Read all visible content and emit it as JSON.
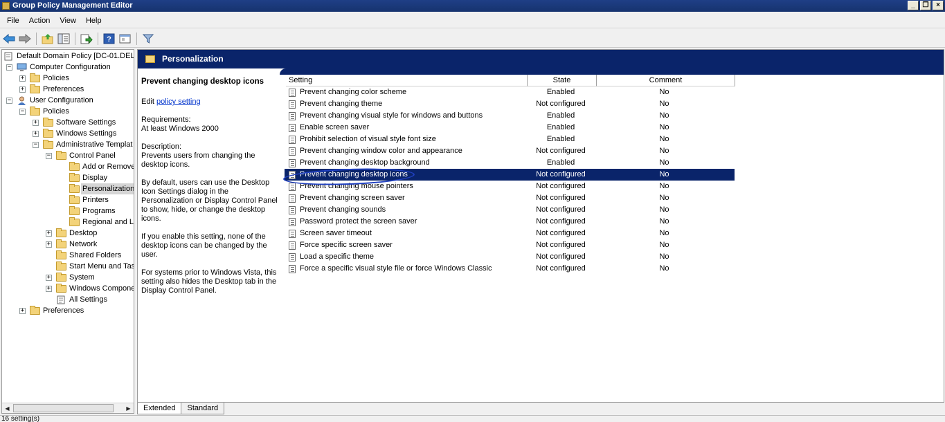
{
  "window": {
    "title": "Group Policy Management Editor"
  },
  "menu": [
    "File",
    "Action",
    "View",
    "Help"
  ],
  "toolbar": {
    "icons": [
      "back-arrow-icon",
      "forward-arrow-icon",
      "up-folder-icon",
      "show-hide-tree-icon",
      "export-list-icon",
      "help-icon",
      "properties-icon",
      "filter-icon"
    ]
  },
  "tree": [
    {
      "label": "Default Domain Policy [DC-01.DELT",
      "icon": "gpo-scroll-icon",
      "expander": "",
      "selected": false
    },
    {
      "label": "Computer Configuration",
      "icon": "computer-icon",
      "expander": "−",
      "selected": false
    },
    {
      "label": "Policies",
      "icon": "folder-icon",
      "expander": "+",
      "selected": false
    },
    {
      "label": "Preferences",
      "icon": "folder-icon",
      "expander": "+",
      "selected": false
    },
    {
      "label": "User Configuration",
      "icon": "user-icon",
      "expander": "−",
      "selected": false
    },
    {
      "label": "Policies",
      "icon": "folder-icon",
      "expander": "−",
      "selected": false
    },
    {
      "label": "Software Settings",
      "icon": "folder-icon",
      "expander": "+",
      "selected": false
    },
    {
      "label": "Windows Settings",
      "icon": "folder-icon",
      "expander": "+",
      "selected": false
    },
    {
      "label": "Administrative Templat",
      "icon": "folder-icon",
      "expander": "−",
      "selected": false
    },
    {
      "label": "Control Panel",
      "icon": "folder-icon",
      "expander": "−",
      "selected": false
    },
    {
      "label": "Add or Remove",
      "icon": "folder-icon",
      "expander": "",
      "selected": false
    },
    {
      "label": "Display",
      "icon": "folder-icon",
      "expander": "",
      "selected": false
    },
    {
      "label": "Personalization",
      "icon": "folder-icon",
      "expander": "",
      "selected": true
    },
    {
      "label": "Printers",
      "icon": "folder-icon",
      "expander": "",
      "selected": false
    },
    {
      "label": "Programs",
      "icon": "folder-icon",
      "expander": "",
      "selected": false
    },
    {
      "label": "Regional and La",
      "icon": "folder-icon",
      "expander": "",
      "selected": false
    },
    {
      "label": "Desktop",
      "icon": "folder-icon",
      "expander": "+",
      "selected": false
    },
    {
      "label": "Network",
      "icon": "folder-icon",
      "expander": "+",
      "selected": false
    },
    {
      "label": "Shared Folders",
      "icon": "folder-icon",
      "expander": "",
      "selected": false
    },
    {
      "label": "Start Menu and Tas",
      "icon": "folder-icon",
      "expander": "",
      "selected": false
    },
    {
      "label": "System",
      "icon": "folder-icon",
      "expander": "+",
      "selected": false
    },
    {
      "label": "Windows Compone",
      "icon": "folder-icon",
      "expander": "+",
      "selected": false
    },
    {
      "label": "All Settings",
      "icon": "all-settings-icon",
      "expander": "",
      "selected": false
    },
    {
      "label": "Preferences",
      "icon": "folder-icon",
      "expander": "+",
      "selected": false
    }
  ],
  "right": {
    "header": "Personalization",
    "description": {
      "title": "Prevent changing desktop icons",
      "edit_prefix": "Edit ",
      "edit_link": "policy setting",
      "requirements_label": "Requirements:",
      "requirements": "At least Windows 2000",
      "description_label": "Description:",
      "p1": "Prevents users from changing the desktop icons.",
      "p2": "By default, users can use the Desktop Icon Settings dialog in the Personalization or Display Control Panel to show, hide, or change the desktop icons.",
      "p3": "If you enable this setting, none of the desktop icons can be changed by the user.",
      "p4": "For systems prior to Windows Vista, this setting also hides the Desktop tab in the Display Control Panel."
    },
    "columns": [
      "Setting",
      "State",
      "Comment"
    ],
    "settings": [
      {
        "name": "Prevent changing color scheme",
        "state": "Enabled",
        "comment": "No",
        "selected": false
      },
      {
        "name": "Prevent changing theme",
        "state": "Not configured",
        "comment": "No",
        "selected": false
      },
      {
        "name": "Prevent changing visual style for windows and buttons",
        "state": "Enabled",
        "comment": "No",
        "selected": false
      },
      {
        "name": "Enable screen saver",
        "state": "Enabled",
        "comment": "No",
        "selected": false
      },
      {
        "name": "Prohibit selection of visual style font size",
        "state": "Enabled",
        "comment": "No",
        "selected": false
      },
      {
        "name": "Prevent changing window color and appearance",
        "state": "Not configured",
        "comment": "No",
        "selected": false
      },
      {
        "name": "Prevent changing desktop background",
        "state": "Enabled",
        "comment": "No",
        "selected": false
      },
      {
        "name": "Prevent changing desktop icons",
        "state": "Not configured",
        "comment": "No",
        "selected": true
      },
      {
        "name": "Prevent changing mouse pointers",
        "state": "Not configured",
        "comment": "No",
        "selected": false
      },
      {
        "name": "Prevent changing screen saver",
        "state": "Not configured",
        "comment": "No",
        "selected": false
      },
      {
        "name": "Prevent changing sounds",
        "state": "Not configured",
        "comment": "No",
        "selected": false
      },
      {
        "name": "Password protect the screen saver",
        "state": "Not configured",
        "comment": "No",
        "selected": false
      },
      {
        "name": "Screen saver timeout",
        "state": "Not configured",
        "comment": "No",
        "selected": false
      },
      {
        "name": "Force specific screen saver",
        "state": "Not configured",
        "comment": "No",
        "selected": false
      },
      {
        "name": "Load a specific theme",
        "state": "Not configured",
        "comment": "No",
        "selected": false
      },
      {
        "name": "Force a specific visual style file or force Windows Classic",
        "state": "Not configured",
        "comment": "No",
        "selected": false
      }
    ]
  },
  "tabs": [
    {
      "label": "Extended",
      "active": true
    },
    {
      "label": "Standard",
      "active": false
    }
  ],
  "status": "16 setting(s)"
}
